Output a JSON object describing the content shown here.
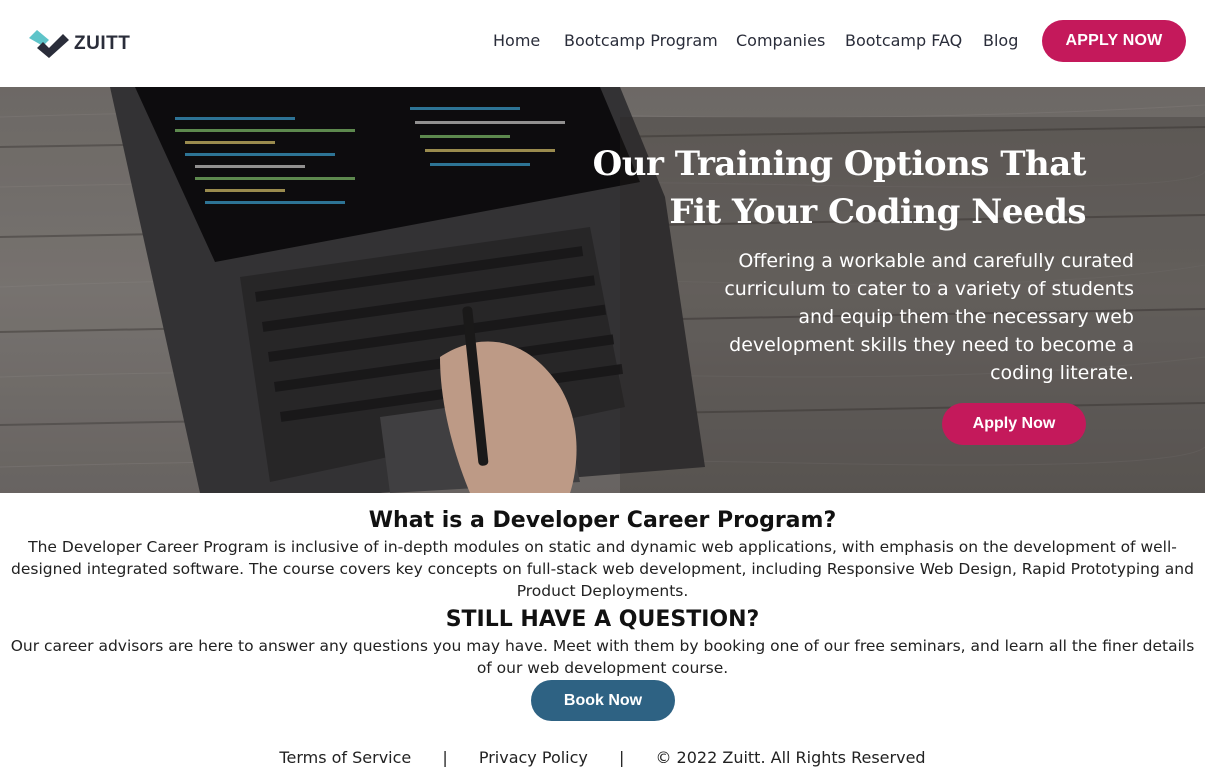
{
  "brand": {
    "name": "ZUITT"
  },
  "nav": {
    "links": [
      "Home",
      "Bootcamp Program",
      "Companies",
      "Bootcamp FAQ",
      "Blog"
    ],
    "apply_label": "APPLY NOW"
  },
  "hero": {
    "title_line1": "Our Training Options That",
    "title_line2": "Fit Your Coding Needs",
    "subtitle": "Offering a workable and carefully curated curriculum to cater to a variety of students and equip them the necessary web development skills they need to become a coding literate.",
    "apply_label": "Apply Now"
  },
  "program": {
    "heading": "What is a Developer Career Program?",
    "text": "The Developer Career Program is inclusive of in-depth modules on static and dynamic web applications, with emphasis on the development of well-designed integrated software. The course covers key concepts on full-stack web development, including Responsive Web Design, Rapid Prototyping and Product Deployments."
  },
  "question": {
    "heading": "STILL HAVE A QUESTION?",
    "text": "Our career advisors are here to answer any questions you may have. Meet with them by booking one of our free seminars, and learn all the finer details of our web development course.",
    "book_label": "Book Now"
  },
  "footer": {
    "terms": "Terms of Service",
    "separator": "|",
    "privacy": "Privacy Policy",
    "copyright": "© 2022 Zuitt. All Rights Reserved"
  },
  "colors": {
    "accent": "#c4195b",
    "secondary": "#2e6283",
    "logo_teal": "#5ec4c9",
    "logo_dark": "#2a2d3a"
  }
}
